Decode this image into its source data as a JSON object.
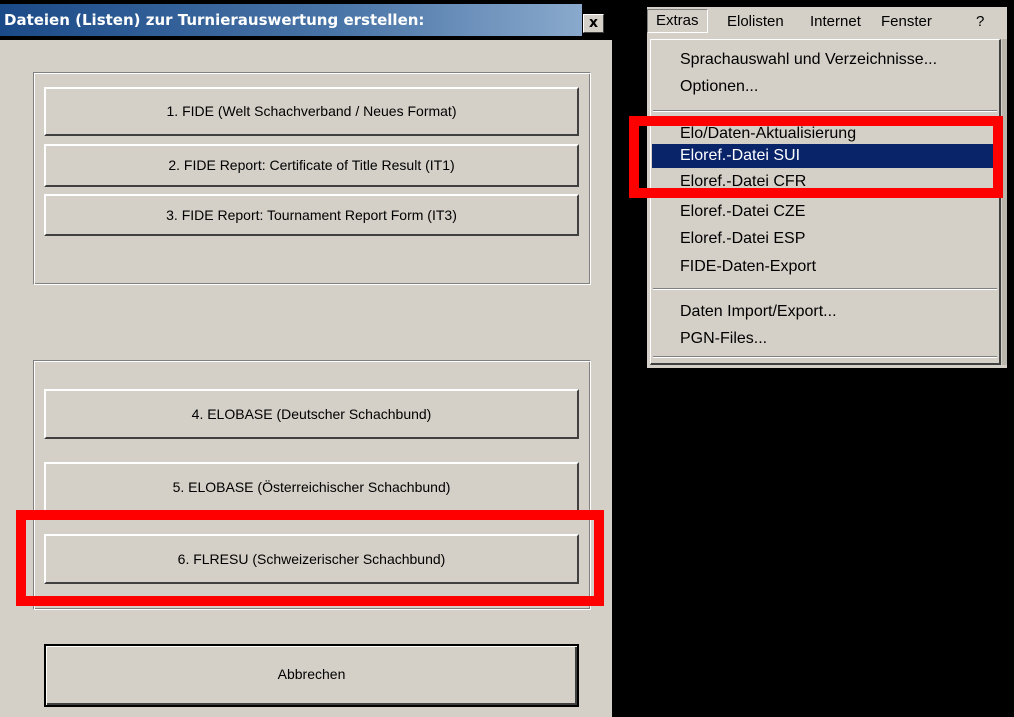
{
  "dialog": {
    "title": "Dateien (Listen) zur Turnierauswertung erstellen:",
    "close_label": "x",
    "buttons": {
      "fide": "1. FIDE (Welt Schachverband / Neues Format)",
      "it1": "2. FIDE Report: Certificate of Title Result (IT1)",
      "it3": "3. FIDE Report: Tournament Report Form (IT3)",
      "elobase_de": "4. ELOBASE (Deutscher Schachbund)",
      "elobase_at": "5. ELOBASE (Österreichischer Schachbund)",
      "flresu": "6. FLRESU  (Schweizerischer Schachbund)",
      "cancel": "Abbrechen"
    }
  },
  "menubar": {
    "items": [
      "Extras",
      "Elolisten",
      "Internet",
      "Fenster",
      "?"
    ]
  },
  "dropdown": {
    "items": [
      "Sprachauswahl und Verzeichnisse...",
      "Optionen...",
      "Elo/Daten-Aktualisierung",
      "Eloref.-Datei SUI",
      "Eloref.-Datei CFR",
      "Eloref.-Datei CZE",
      "Eloref.-Datei ESP",
      "FIDE-Daten-Export",
      "Daten Import/Export...",
      "PGN-Files..."
    ],
    "selected_index": 3
  },
  "colors": {
    "window_face": "#d4d0c8",
    "title_gradient_start": "#1b4a88",
    "menu_highlight": "#0a246a",
    "annotation_highlight": "#ff0000"
  }
}
